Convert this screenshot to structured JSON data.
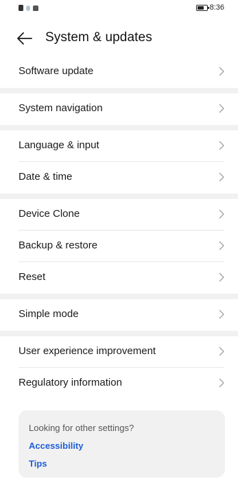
{
  "status_bar": {
    "time": "8:36",
    "left_icons": [
      "notification-icon",
      "weather-icon",
      "robot-icon"
    ],
    "battery_level": 0.6
  },
  "header": {
    "title": "System & updates"
  },
  "groups": [
    [
      {
        "label": "Software update"
      }
    ],
    [
      {
        "label": "System navigation"
      }
    ],
    [
      {
        "label": "Language & input"
      },
      {
        "label": "Date & time"
      }
    ],
    [
      {
        "label": "Device Clone"
      },
      {
        "label": "Backup & restore"
      },
      {
        "label": "Reset"
      }
    ],
    [
      {
        "label": "Simple mode"
      }
    ],
    [
      {
        "label": "User experience improvement"
      },
      {
        "label": "Regulatory information"
      }
    ]
  ],
  "tips": {
    "question": "Looking for other settings?",
    "links": [
      "Accessibility",
      "Tips"
    ]
  },
  "colors": {
    "link": "#1e5fd6",
    "separator_band": "#f1f1f1"
  }
}
